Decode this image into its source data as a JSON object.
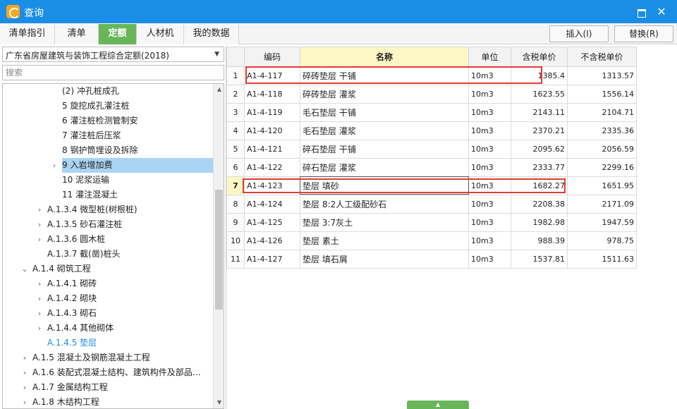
{
  "window": {
    "title": "查询",
    "maximize_label": "",
    "close_label": "✕"
  },
  "tabs": [
    {
      "label": "清单指引",
      "active": false
    },
    {
      "label": "清单",
      "active": false
    },
    {
      "label": "定额",
      "active": true
    },
    {
      "label": "人材机",
      "active": false
    },
    {
      "label": "我的数据",
      "active": false
    }
  ],
  "toolbar": {
    "insert_label": "插入(I)",
    "replace_label": "替换(R)"
  },
  "left": {
    "library_selected": "广东省房屋建筑与装饰工程综合定额(2018)",
    "search_placeholder": "搜索",
    "tree": [
      {
        "label": "(2) 冲孔桩成孔",
        "level": 4,
        "expandable": false
      },
      {
        "label": "5 旋挖成孔灌注桩",
        "level": 4,
        "expandable": false
      },
      {
        "label": "6 灌注桩检测管制安",
        "level": 4,
        "expandable": false
      },
      {
        "label": "7 灌注桩后压浆",
        "level": 4,
        "expandable": false
      },
      {
        "label": "8 钢护筒埋设及拆除",
        "level": 4,
        "expandable": false
      },
      {
        "label": "9 入岩增加费",
        "level": 4,
        "expandable": true,
        "selected": true
      },
      {
        "label": "10 泥浆运输",
        "level": 4,
        "expandable": false
      },
      {
        "label": "11 灌注混凝土",
        "level": 4,
        "expandable": false
      },
      {
        "label": "A.1.3.4 微型桩(树根桩)",
        "level": 3,
        "expandable": true
      },
      {
        "label": "A.1.3.5 砂石灌注桩",
        "level": 3,
        "expandable": true
      },
      {
        "label": "A.1.3.6 圆木桩",
        "level": 3,
        "expandable": true
      },
      {
        "label": "A.1.3.7 截(凿)桩头",
        "level": 3,
        "expandable": false
      },
      {
        "label": "A.1.4 砌筑工程",
        "level": 2,
        "expandable": true,
        "expanded": true
      },
      {
        "label": "A.1.4.1 砌砖",
        "level": 3,
        "expandable": true
      },
      {
        "label": "A.1.4.2 砌块",
        "level": 3,
        "expandable": true
      },
      {
        "label": "A.1.4.3 砌石",
        "level": 3,
        "expandable": true
      },
      {
        "label": "A.1.4.4 其他砌体",
        "level": 3,
        "expandable": true
      },
      {
        "label": "A.1.4.5 垫层",
        "level": 3,
        "expandable": false,
        "current": true
      },
      {
        "label": "A.1.5 混凝土及钢筋混凝土工程",
        "level": 2,
        "expandable": true
      },
      {
        "label": "A.1.6 装配式混凝土结构、建筑构件及部品…",
        "level": 2,
        "expandable": true
      },
      {
        "label": "A.1.7 金属结构工程",
        "level": 2,
        "expandable": true
      },
      {
        "label": "A.1.8 木结构工程",
        "level": 2,
        "expandable": true
      }
    ]
  },
  "grid": {
    "columns": [
      "",
      "编码",
      "名称",
      "单位",
      "含税单价",
      "不含税单价"
    ],
    "current_row": 7,
    "rows": [
      {
        "no": "1",
        "code": "A1-4-117",
        "name": "碎砖垫层 干铺",
        "unit": "10m3",
        "price_tax": "1385.4",
        "price_notax": "1313.57"
      },
      {
        "no": "2",
        "code": "A1-4-118",
        "name": "碎砖垫层 灌浆",
        "unit": "10m3",
        "price_tax": "1623.55",
        "price_notax": "1556.14"
      },
      {
        "no": "3",
        "code": "A1-4-119",
        "name": "毛石垫层 干铺",
        "unit": "10m3",
        "price_tax": "2143.11",
        "price_notax": "2104.71"
      },
      {
        "no": "4",
        "code": "A1-4-120",
        "name": "毛石垫层 灌浆",
        "unit": "10m3",
        "price_tax": "2370.21",
        "price_notax": "2335.36"
      },
      {
        "no": "5",
        "code": "A1-4-121",
        "name": "碎石垫层 干铺",
        "unit": "10m3",
        "price_tax": "2095.62",
        "price_notax": "2056.59"
      },
      {
        "no": "6",
        "code": "A1-4-122",
        "name": "碎石垫层 灌浆",
        "unit": "10m3",
        "price_tax": "2333.77",
        "price_notax": "2299.16"
      },
      {
        "no": "7",
        "code": "A1-4-123",
        "name": "垫层 填砂",
        "unit": "10m3",
        "price_tax": "1682.27",
        "price_notax": "1651.95"
      },
      {
        "no": "8",
        "code": "A1-4-124",
        "name": "垫层 8:2人工级配砂石",
        "unit": "10m3",
        "price_tax": "2208.38",
        "price_notax": "2171.09"
      },
      {
        "no": "9",
        "code": "A1-4-125",
        "name": "垫层 3:7灰土",
        "unit": "10m3",
        "price_tax": "1982.98",
        "price_notax": "1947.59"
      },
      {
        "no": "10",
        "code": "A1-4-126",
        "name": "垫层 素土",
        "unit": "10m3",
        "price_tax": "988.39",
        "price_notax": "978.75"
      },
      {
        "no": "11",
        "code": "A1-4-127",
        "name": "垫层 填石屑",
        "unit": "10m3",
        "price_tax": "1537.81",
        "price_notax": "1511.63"
      }
    ]
  },
  "colors": {
    "titlebar": "#1a8ee6",
    "tab_active": "#68b55a",
    "highlight": "#e53935",
    "selection": "#a9d4f3"
  },
  "icons": {
    "app": "app-logo-icon",
    "maximize": "maximize-icon",
    "close": "close-icon",
    "dropdown": "chevron-down-icon",
    "expand": "chevron-right-icon",
    "collapse": "chevron-down-icon"
  }
}
